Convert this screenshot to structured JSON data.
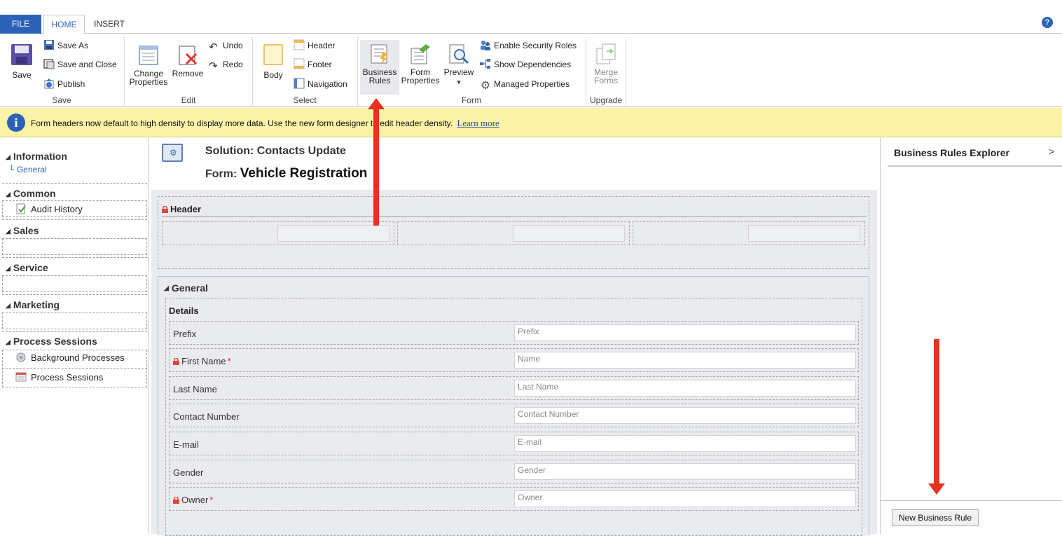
{
  "tabs": {
    "file": "FILE",
    "home": "HOME",
    "insert": "INSERT"
  },
  "help_icon": "?",
  "ribbon": {
    "save_group": {
      "save": "Save",
      "save_as": "Save As",
      "save_and_close": "Save and Close",
      "publish": "Publish",
      "label": "Save"
    },
    "edit_group": {
      "change_properties_line1": "Change",
      "change_properties_line2": "Properties",
      "remove": "Remove",
      "undo": "Undo",
      "redo": "Redo",
      "label": "Edit"
    },
    "select_group": {
      "body": "Body",
      "header": "Header",
      "footer": "Footer",
      "navigation": "Navigation",
      "label": "Select"
    },
    "form_group": {
      "business_rules_line1": "Business",
      "business_rules_line2": "Rules",
      "form_properties_line1": "Form",
      "form_properties_line2": "Properties",
      "preview": "Preview",
      "enable_security_roles": "Enable Security Roles",
      "show_dependencies": "Show Dependencies",
      "managed_properties": "Managed Properties",
      "label": "Form"
    },
    "upgrade_group": {
      "merge_forms_line1": "Merge",
      "merge_forms_line2": "Forms",
      "label": "Upgrade"
    }
  },
  "notification": {
    "text": "Form headers now default to high density to display more data. Use the new form designer to edit header density.",
    "link": "Learn more"
  },
  "leftnav": {
    "information": "Information",
    "general": "General",
    "common": "Common",
    "audit_history": "Audit History",
    "sales": "Sales",
    "service": "Service",
    "marketing": "Marketing",
    "process_sessions_heading": "Process Sessions",
    "background_processes": "Background Processes",
    "process_sessions_item": "Process Sessions"
  },
  "header_area": {
    "solution_prefix": "Solution:",
    "solution_name": "Contacts Update",
    "form_prefix": "Form:",
    "form_name": "Vehicle Registration"
  },
  "form": {
    "header_section": "Header",
    "general_tab": "General",
    "details_section": "Details",
    "fields": [
      {
        "label": "Prefix",
        "placeholder": "Prefix",
        "required": "",
        "locked": false
      },
      {
        "label": "First Name",
        "placeholder": "Name",
        "required": "*",
        "locked": true
      },
      {
        "label": "Last Name",
        "placeholder": "Last Name",
        "required": "",
        "locked": false
      },
      {
        "label": "Contact Number",
        "placeholder": "Contact Number",
        "required": "",
        "locked": false
      },
      {
        "label": "E-mail",
        "placeholder": "E-mail",
        "required": "",
        "locked": false
      },
      {
        "label": "Gender",
        "placeholder": "Gender",
        "required": "",
        "locked": false
      },
      {
        "label": "Owner",
        "placeholder": "Owner",
        "required": "*",
        "locked": true
      }
    ]
  },
  "right_panel": {
    "title": "Business Rules Explorer",
    "chevron": ">",
    "new_rule_button": "New Business Rule"
  },
  "colors": {
    "accent": "#2b62b8",
    "notification_bg": "#fbf3a7",
    "annotation_arrow": "#e8321e",
    "required": "#dd2222"
  }
}
